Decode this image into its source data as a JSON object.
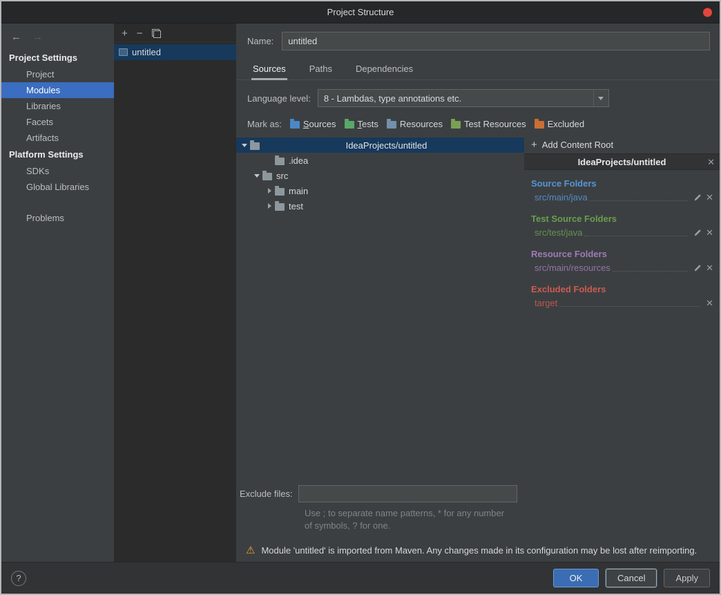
{
  "window": {
    "title": "Project Structure"
  },
  "colors": {
    "sidebar_selection": "#3b6dc0",
    "list_selection": "#16395c",
    "tree_selection": "#16395c",
    "ok_button": "#3a6db3",
    "warning_icon": "#e9a33f"
  },
  "sidebar": {
    "back_icon": "←",
    "forward_icon": "→",
    "sections": [
      {
        "header": "Project Settings",
        "items": [
          {
            "label": "Project",
            "selected": false
          },
          {
            "label": "Modules",
            "selected": true
          },
          {
            "label": "Libraries",
            "selected": false
          },
          {
            "label": "Facets",
            "selected": false
          },
          {
            "label": "Artifacts",
            "selected": false
          }
        ]
      },
      {
        "header": "Platform Settings",
        "items": [
          {
            "label": "SDKs",
            "selected": false
          },
          {
            "label": "Global Libraries",
            "selected": false
          }
        ]
      },
      {
        "header": "",
        "items": [
          {
            "label": "Problems",
            "selected": false
          }
        ]
      }
    ]
  },
  "module_list": {
    "toolbar": {
      "add_icon": "+",
      "remove_icon": "−"
    },
    "items": [
      {
        "label": "untitled",
        "selected": true
      }
    ]
  },
  "form": {
    "name_label": "Name:",
    "name_value": "untitled",
    "tabs": [
      {
        "label": "Sources",
        "selected": true
      },
      {
        "label": "Paths",
        "selected": false
      },
      {
        "label": "Dependencies",
        "selected": false
      }
    ],
    "language_level_label": "Language level:",
    "language_level_value": "8 - Lambdas, type annotations etc.",
    "mark_as_label": "Mark as:",
    "mark_as_options": [
      {
        "label": "Sources",
        "color": "#4a88c7"
      },
      {
        "label": "Tests",
        "color": "#59a869"
      },
      {
        "label": "Resources",
        "color": "#7390ad"
      },
      {
        "label": "Test Resources",
        "color": "#7aa053"
      },
      {
        "label": "Excluded",
        "color": "#c96f34"
      }
    ]
  },
  "tree": {
    "items": [
      {
        "label": "IdeaProjects/untitled",
        "level": 0,
        "arrow": "down",
        "selected": true
      },
      {
        "label": ".idea",
        "level": 2,
        "arrow": "none",
        "selected": false
      },
      {
        "label": "src",
        "level": 1,
        "arrow": "down",
        "selected": false
      },
      {
        "label": "main",
        "level": 2,
        "arrow": "right",
        "selected": false
      },
      {
        "label": "test",
        "level": 2,
        "arrow": "right",
        "selected": false
      }
    ]
  },
  "detail": {
    "add_icon": "+",
    "add_content_root": "Add Content Root",
    "header": "IdeaProjects/untitled",
    "close_icon": "✕",
    "groups": [
      {
        "title": "Source Folders",
        "color": "#5695d6",
        "items": [
          {
            "path": "src/main/java",
            "editable": true
          }
        ]
      },
      {
        "title": "Test Source Folders",
        "color": "#699e51",
        "items": [
          {
            "path": "src/test/java",
            "editable": true
          }
        ]
      },
      {
        "title": "Resource Folders",
        "color": "#9d7cb8",
        "items": [
          {
            "path": "src/main/resources",
            "editable": true
          }
        ]
      },
      {
        "title": "Excluded Folders",
        "color": "#cc5b51",
        "items": [
          {
            "path": "target",
            "editable": false
          }
        ]
      }
    ]
  },
  "exclude": {
    "label": "Exclude files:",
    "value": "",
    "hint": "Use ; to separate name patterns, * for any number of symbols, ? for one."
  },
  "warning": {
    "icon": "⚠",
    "text": "Module 'untitled' is imported from Maven. Any changes made in its configuration may be lost after reimporting."
  },
  "footer": {
    "help": "?",
    "ok": "OK",
    "cancel": "Cancel",
    "apply": "Apply"
  }
}
